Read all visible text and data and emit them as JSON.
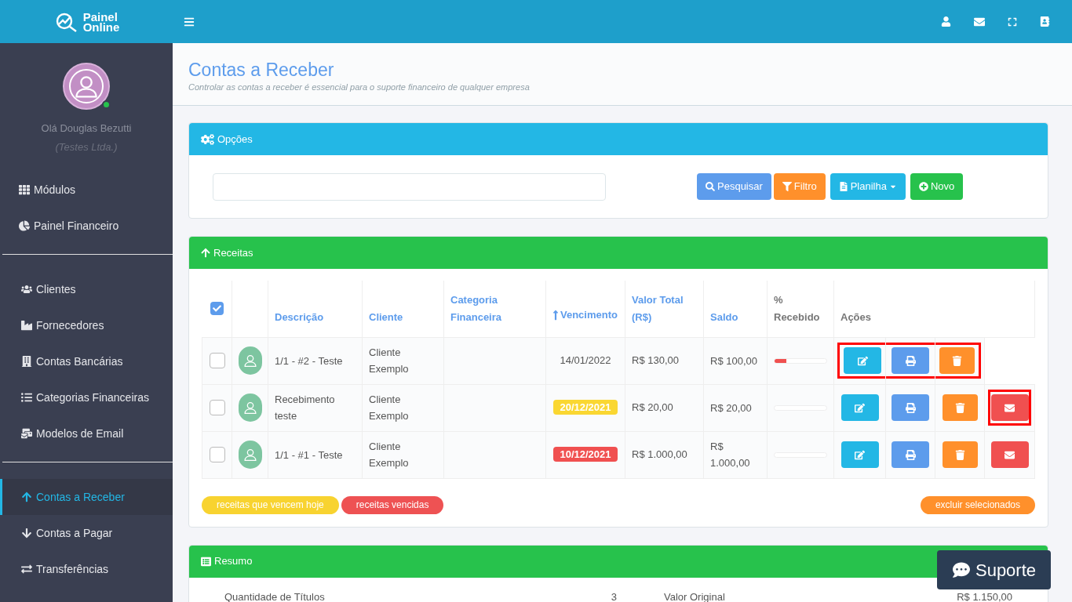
{
  "header": {
    "logo_line1": "Painel",
    "logo_line2": "Online"
  },
  "sidebar": {
    "user_greeting": "Olá Douglas Bezutti",
    "company": "(Testes Ltda.)",
    "online": true,
    "groups": [
      [
        {
          "label": "Módulos",
          "selected": false
        },
        {
          "label": "Painel Financeiro",
          "selected": false
        }
      ],
      [
        {
          "label": "Clientes",
          "selected": false
        },
        {
          "label": "Fornecedores",
          "selected": false
        },
        {
          "label": "Contas Bancárias",
          "selected": false
        },
        {
          "label": "Categorias Financeiras",
          "selected": false
        },
        {
          "label": "Modelos de Email",
          "selected": false
        }
      ],
      [
        {
          "label": "Contas a Receber",
          "selected": true
        },
        {
          "label": "Contas a Pagar",
          "selected": false
        },
        {
          "label": "Transferências",
          "selected": false
        }
      ]
    ]
  },
  "page": {
    "title": "Contas a Receber",
    "subtitle": "Controlar as contas a receber é essencial para o suporte financeiro de qualquer empresa"
  },
  "options_panel": {
    "title": "Opções",
    "buttons": [
      {
        "label": "Pesquisar",
        "kind": "search"
      },
      {
        "label": "Filtro",
        "kind": "filter"
      },
      {
        "label": "Planilha",
        "kind": "sheet"
      },
      {
        "label": "Novo",
        "kind": "new"
      }
    ]
  },
  "receitas_panel": {
    "title": "Receitas",
    "select_all_checked": true,
    "columns": [
      {
        "label": "Descrição",
        "kind": "link",
        "sorted": false
      },
      {
        "label": "Cliente",
        "kind": "link",
        "sorted": false
      },
      {
        "label": "Categoria Financeira",
        "kind": "link",
        "sorted": false
      },
      {
        "label": "Vencimento",
        "kind": "link",
        "sorted": true
      },
      {
        "label": "Valor Total (R$)",
        "kind": "link",
        "sorted": false
      },
      {
        "label": "Saldo",
        "kind": "link",
        "sorted": false
      },
      {
        "label": "% Recebido",
        "kind": "plain",
        "sorted": false
      },
      {
        "label": "Ações",
        "kind": "plain",
        "sorted": false
      }
    ],
    "rows": [
      {
        "checked": false,
        "description": "1/1 - #2 - Teste",
        "client": "Cliente Exemplo",
        "due": {
          "text": "14/01/2022",
          "kind": "normal"
        },
        "total": "R$ 130,00",
        "balance": "R$ 100,00",
        "level": 0.23,
        "actions": [
          {
            "kind": "edit",
            "highlighted": true
          },
          {
            "kind": "print",
            "highlighted": true
          },
          {
            "kind": "delete",
            "highlighted": true
          }
        ]
      },
      {
        "checked": false,
        "description": "Recebimento teste",
        "client": "Cliente Exemplo",
        "due": {
          "text": "20/12/2021",
          "kind": "today"
        },
        "total": "R$ 20,00",
        "balance": "R$ 20,00",
        "level": 0,
        "actions": [
          {
            "kind": "edit",
            "highlighted": false
          },
          {
            "kind": "print",
            "highlighted": false
          },
          {
            "kind": "delete",
            "highlighted": false
          },
          {
            "kind": "email",
            "highlighted": true
          }
        ]
      },
      {
        "checked": false,
        "description": "1/1 - #1 - Teste",
        "client": "Cliente Exemplo",
        "due": {
          "text": "10/12/2021",
          "kind": "overdue"
        },
        "total": "R$ 1.000,00",
        "balance": "R$ 1.000,00",
        "level": 0,
        "actions": [
          {
            "kind": "edit",
            "highlighted": false
          },
          {
            "kind": "print",
            "highlighted": false
          },
          {
            "kind": "delete",
            "highlighted": false
          },
          {
            "kind": "email",
            "highlighted": false
          }
        ]
      }
    ],
    "legend": [
      {
        "label": "receitas que vencem hoje",
        "color": "#f8d330"
      },
      {
        "label": "receitas vencidas",
        "color": "#ee5253"
      }
    ],
    "delete_selected": "excluir selecionados"
  },
  "resumo_panel": {
    "title": "Resumo",
    "rows": [
      {
        "label": "Quantidade de Títulos",
        "value": "3",
        "label2": "Valor Original",
        "value2": "R$ 1.150,00"
      }
    ]
  },
  "support_button": "Suporte"
}
